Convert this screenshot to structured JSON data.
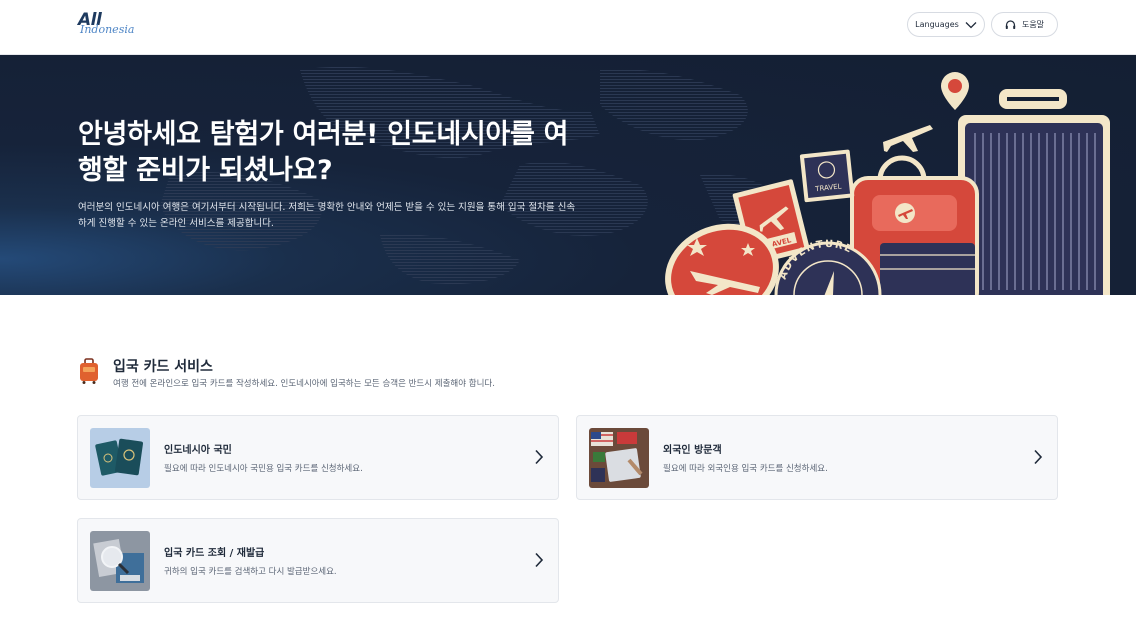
{
  "header": {
    "logo_line1": "All",
    "logo_line2": "Indonesia",
    "languages_label": "Languages",
    "help_label": "도움말"
  },
  "hero": {
    "title": "안녕하세요 탐험가 여러분! 인도네시아를 여행할 준비가 되셨나요?",
    "description": "여러분의 인도네시아 여행은 여기서부터 시작됩니다. 저희는 명확한 안내와 언제든 받을 수 있는 지원을 통해 입국 절차를 신속하게 진행할 수 있는 온라인 서비스를 제공합니다.",
    "stamp_travel_label": "TRAVEL",
    "stamp_small_label": "TRAVEL",
    "badge_label": "ADVENTURE"
  },
  "section": {
    "title": "입국 카드 서비스",
    "subtitle": "여행 전에 온라인으로 입국 카드를 작성하세요. 인도네시아에 입국하는 모든 승객은 반드시 제출해야 합니다."
  },
  "cards": [
    {
      "title": "인도네시아 국민",
      "description": "필요에 따라 인도네시아 국민용 입국 카드를 신청하세요."
    },
    {
      "title": "외국인 방문객",
      "description": "필요에 따라 외국인용 입국 카드를 신청하세요."
    },
    {
      "title": "입국 카드 조회 / 재발급",
      "description": "귀하의 입국 카드를 검색하고 다시 발급받으세요."
    }
  ],
  "colors": {
    "hero_bg": "#141f33",
    "accent_red": "#d5483b",
    "cream": "#f3e6c8",
    "navy_suitcase": "#2e3257"
  },
  "icons": {
    "languages": "chevron-down-icon",
    "help": "headset-icon",
    "section": "luggage-icon",
    "card_arrow": "chevron-right-icon"
  }
}
